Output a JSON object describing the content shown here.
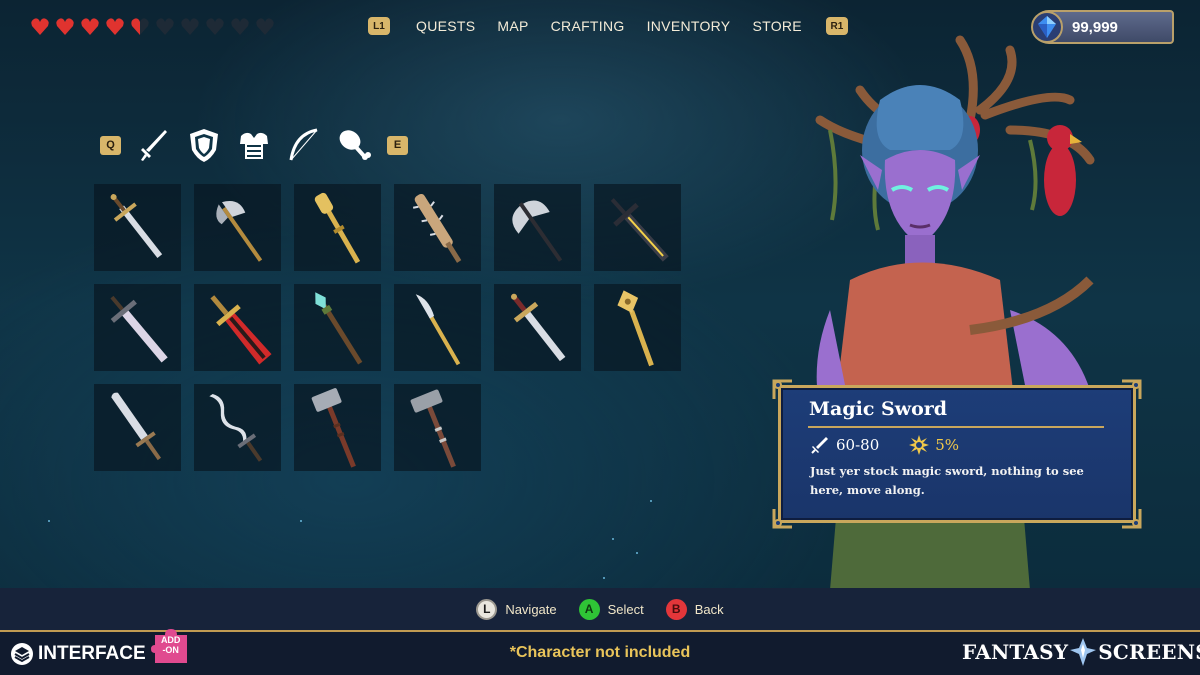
{
  "hud": {
    "hearts": {
      "filled": 4,
      "half": 1,
      "empty": 5
    },
    "nav": {
      "left_hint": "L1",
      "right_hint": "R1",
      "tabs": [
        {
          "label": "QUESTS"
        },
        {
          "label": "MAP"
        },
        {
          "label": "CRAFTING"
        },
        {
          "label": "INVENTORY"
        },
        {
          "label": "STORE"
        }
      ]
    },
    "currency": {
      "value": "99,999",
      "icon": "blue-gem-icon"
    }
  },
  "categories": {
    "prev_hint": "Q",
    "next_hint": "E",
    "items": [
      {
        "name": "sword",
        "icon": "sword-icon"
      },
      {
        "name": "shield",
        "icon": "shield-icon"
      },
      {
        "name": "armor",
        "icon": "armor-icon"
      },
      {
        "name": "bow",
        "icon": "bow-icon"
      },
      {
        "name": "food",
        "icon": "drumstick-icon"
      }
    ]
  },
  "inventory": {
    "slots": [
      {
        "icon": "longsword-icon"
      },
      {
        "icon": "halberd-icon"
      },
      {
        "icon": "golden-scepter-icon"
      },
      {
        "icon": "spiked-club-icon"
      },
      {
        "icon": "battle-axe-icon"
      },
      {
        "icon": "dark-blade-icon"
      },
      {
        "icon": "broadsword-icon"
      },
      {
        "icon": "red-greatsword-icon"
      },
      {
        "icon": "crystal-staff-icon"
      },
      {
        "icon": "glaive-icon"
      },
      {
        "icon": "knight-sword-icon"
      },
      {
        "icon": "gold-mace-icon"
      },
      {
        "icon": "short-sword-icon"
      },
      {
        "icon": "serpent-blade-icon"
      },
      {
        "icon": "war-hammer-icon"
      },
      {
        "icon": "iron-hammer-icon"
      }
    ]
  },
  "tooltip": {
    "title": "Magic Sword",
    "damage": "60-80",
    "crit": "5%",
    "description": "Just yer stock magic sword, nothing to see here, move along."
  },
  "controls": [
    {
      "button": "L",
      "label": "Navigate"
    },
    {
      "button": "A",
      "label": "Select"
    },
    {
      "button": "B",
      "label": "Back"
    }
  ],
  "footer": {
    "brand_left": "INTERFACE",
    "addon_line1": "ADD",
    "addon_line2": "-ON",
    "disclaimer": "*Character not included",
    "brand_right_1": "FANTASY",
    "brand_right_2": "SCREENS"
  },
  "colors": {
    "heart": "#e0332f",
    "heart_empty": "#1e2a36",
    "gold": "#c9a75c",
    "tooltip_bg": "#1d3d78",
    "disclaimer": "#e9c45a"
  }
}
